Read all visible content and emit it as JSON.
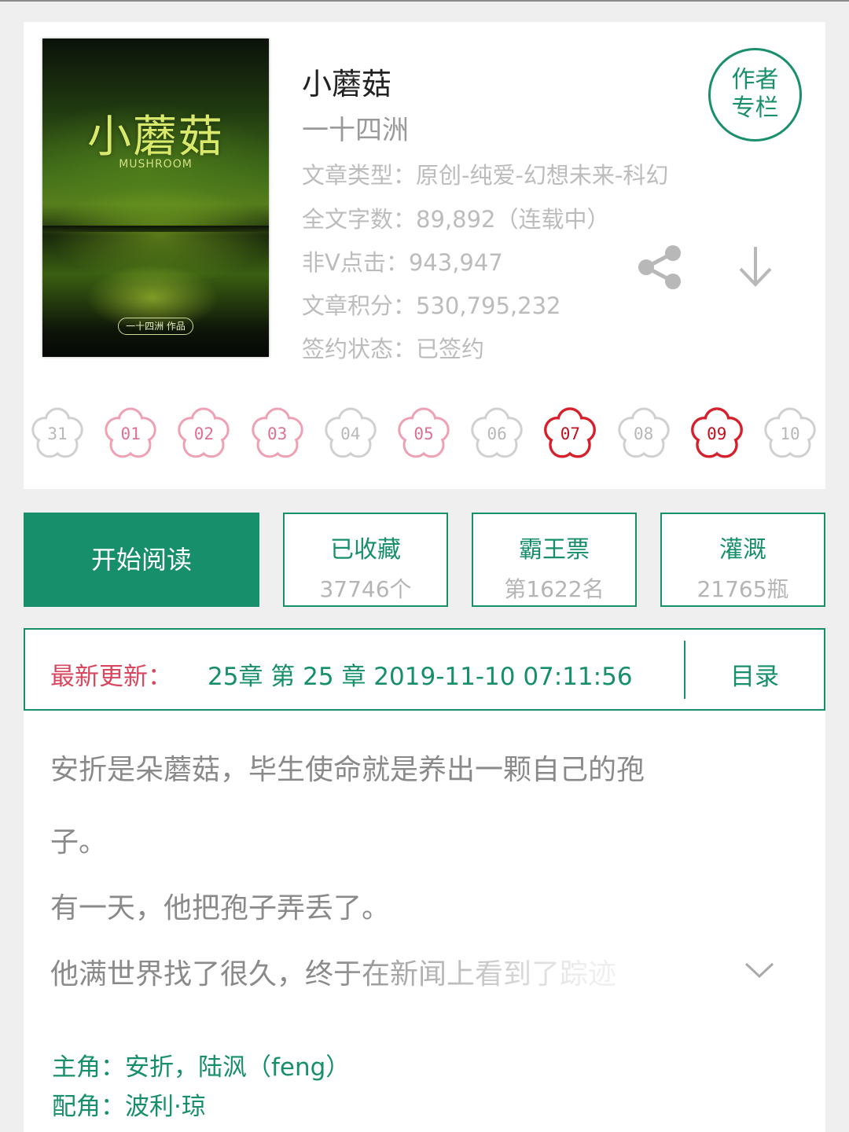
{
  "book": {
    "cover": {
      "title": "小蘑菇",
      "subtitle": "MUSHROOM",
      "author": "一十四洲  作品"
    },
    "title": "小蘑菇",
    "author": "一十四洲",
    "meta": [
      "文章类型：原创-纯爱-幻想未来-科幻",
      "全文字数：89,892（连载中）",
      "非V点击：943,947",
      "文章积分：530,795,232",
      "签约状态：已签约"
    ],
    "author_badge": [
      "作者",
      "专栏"
    ]
  },
  "flowers": [
    {
      "label": "31",
      "state": "inactive"
    },
    {
      "label": "01",
      "state": "pink"
    },
    {
      "label": "02",
      "state": "pink"
    },
    {
      "label": "03",
      "state": "pink"
    },
    {
      "label": "04",
      "state": "inactive"
    },
    {
      "label": "05",
      "state": "pink"
    },
    {
      "label": "06",
      "state": "inactive"
    },
    {
      "label": "07",
      "state": "red"
    },
    {
      "label": "08",
      "state": "inactive"
    },
    {
      "label": "09",
      "state": "red"
    },
    {
      "label": "10",
      "state": "inactive"
    }
  ],
  "actions": {
    "read": "开始阅读",
    "collect": {
      "label": "已收藏",
      "value": "37746个"
    },
    "vote": {
      "label": "霸王票",
      "value": "第1622名"
    },
    "water": {
      "label": "灌溉",
      "value": "21765瓶"
    }
  },
  "update": {
    "label": "最新更新：",
    "text": "25章  第 25 章  2019-11-10 07:11:56",
    "toc": "目录"
  },
  "description": {
    "lines": [
      "安折是朵蘑菇，毕生使命就是养出一颗自己的孢",
      "子。",
      "有一天，他把孢子弄丢了。",
      "他满世界找了很久，终于在新闻上看到了踪迹"
    ],
    "roles": [
      "主角：安折，陆沨（feng）",
      "配角：波利·琼"
    ]
  },
  "colors": {
    "accent": "#168f6a",
    "update_label": "#d9475f",
    "flower_pink": "#f0a0b4",
    "flower_red": "#d8202c",
    "flower_gray": "#d0d0d0"
  },
  "icons": [
    "share-icon",
    "download-icon",
    "chevron-down-icon",
    "flower-icon"
  ]
}
